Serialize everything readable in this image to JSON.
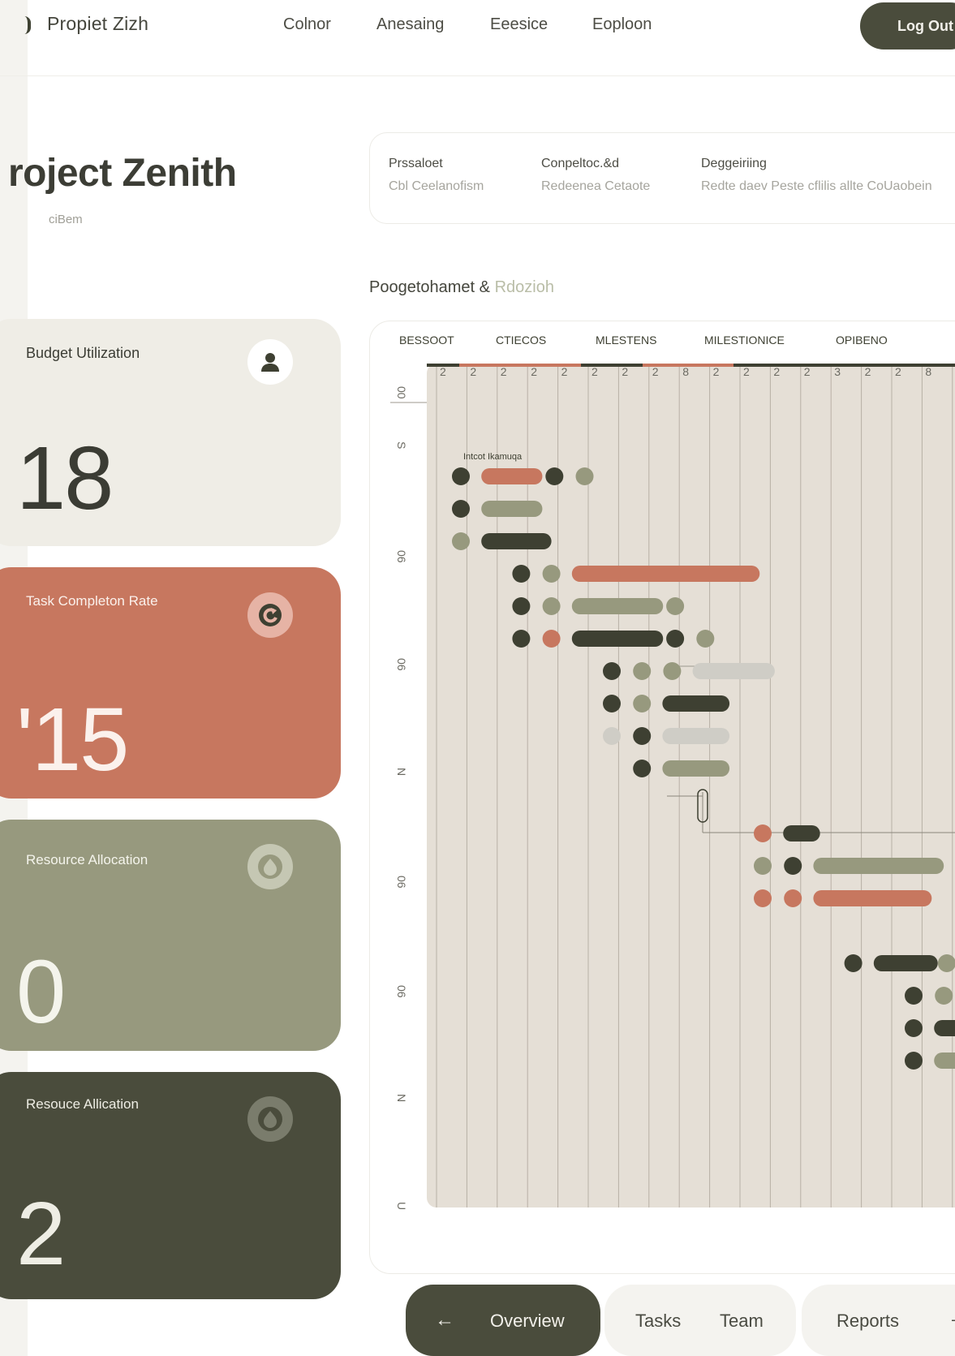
{
  "header": {
    "brand": "Propiet Zizh",
    "nav": [
      "Colnor",
      "Anesaing",
      "Eeesice",
      "Eoploon"
    ],
    "logout": "Log Out"
  },
  "project": {
    "title": "roject Zenith",
    "subtitle": "ciBem"
  },
  "info": [
    {
      "label": "Prssaloet",
      "value": "Cbl Ceelanofism"
    },
    {
      "label": "Conpeltoc.&d",
      "value": "Redeenea Cetaote"
    },
    {
      "label": "Deggeiriing",
      "value": "Redte daev Peste cflilis allte CoUaobein"
    }
  ],
  "cards": [
    {
      "label": "Budget Utilization",
      "value": "18",
      "icon": "person-icon"
    },
    {
      "label": "Task Completon Rate",
      "value": "'15",
      "icon": "refresh-icon"
    },
    {
      "label": "Resource Allocation",
      "value": "0",
      "icon": "drop-icon"
    },
    {
      "label": "Resouce Allication",
      "value": "2",
      "icon": "drop-icon"
    }
  ],
  "chart_heading": {
    "main": "Poogetohamet & ",
    "accent": "Rdozioh"
  },
  "chart_data": {
    "type": "gantt",
    "columns": [
      "BESSOOT",
      "CTIECOS",
      "MLESTENS",
      "MILESTIONICE",
      "OPIBENO"
    ],
    "scale": [
      "2",
      "2",
      "2",
      "2",
      "2",
      "2",
      "2",
      "2",
      "8",
      "2",
      "2",
      "2",
      "2",
      "3",
      "2",
      "2",
      "8"
    ],
    "row_labels": [
      "00",
      "S",
      "06",
      "06",
      "N",
      "06",
      "06",
      "N",
      "U"
    ],
    "task_label": "Intcot Ikamuqa",
    "colors": {
      "dark": "#3e4032",
      "terra": "#c7775f",
      "sage": "#97997e",
      "light": "#cfcdc6",
      "grid_bg": "#e5dfd6"
    },
    "rows": [
      [
        [
          "d",
          "dark",
          0
        ],
        [
          "b",
          "terra",
          1,
          2.7
        ],
        [
          "d",
          "dark",
          3.1
        ],
        [
          "d",
          "sage",
          4.1
        ]
      ],
      [
        [
          "d",
          "dark",
          0
        ],
        [
          "b",
          "sage",
          1,
          2.7
        ]
      ],
      [
        [
          "d",
          "sage",
          0
        ],
        [
          "b",
          "dark",
          1,
          3
        ]
      ],
      [
        [
          "d",
          "dark",
          2
        ],
        [
          "d",
          "sage",
          3
        ],
        [
          "b",
          "terra",
          4,
          9.9
        ]
      ],
      [
        [
          "d",
          "dark",
          2
        ],
        [
          "d",
          "sage",
          3
        ],
        [
          "b",
          "sage",
          4,
          6.7
        ],
        [
          "d",
          "sage",
          7.1
        ]
      ],
      [
        [
          "d",
          "dark",
          2
        ],
        [
          "d",
          "terra",
          3
        ],
        [
          "b",
          "dark",
          4,
          6.7
        ],
        [
          "d",
          "dark",
          7.1
        ],
        [
          "d",
          "sage",
          8.1
        ]
      ],
      [
        [
          "d",
          "dark",
          5
        ],
        [
          "d",
          "sage",
          6
        ],
        [
          "d",
          "sage",
          7
        ],
        [
          "b",
          "light",
          8,
          10.4
        ]
      ],
      [
        [
          "d",
          "dark",
          5
        ],
        [
          "d",
          "sage",
          6
        ],
        [
          "b",
          "dark",
          7,
          8.9
        ]
      ],
      [
        [
          "d",
          "light",
          5
        ],
        [
          "d",
          "dark",
          6
        ],
        [
          "b",
          "light",
          7,
          8.9
        ]
      ],
      [
        [
          "d",
          "dark",
          6
        ],
        [
          "b",
          "sage",
          7,
          8.9
        ]
      ],
      [],
      [
        [
          "d",
          "terra",
          10
        ],
        [
          "b",
          "dark",
          11,
          11.9
        ]
      ],
      [
        [
          "d",
          "sage",
          10
        ],
        [
          "d",
          "dark",
          11
        ],
        [
          "b",
          "sage",
          12,
          16
        ]
      ],
      [
        [
          "d",
          "terra",
          10
        ],
        [
          "d",
          "terra",
          11
        ],
        [
          "b",
          "terra",
          12,
          15.6
        ]
      ],
      [],
      [
        [
          "d",
          "dark",
          13
        ],
        [
          "b",
          "dark",
          14,
          15.8
        ],
        [
          "d",
          "sage",
          16.1
        ],
        [
          "d",
          "light",
          17.1
        ]
      ],
      [
        [
          "d",
          "dark",
          15
        ],
        [
          "d",
          "sage",
          16
        ],
        [
          "b",
          "light",
          17,
          18.5
        ]
      ],
      [
        [
          "d",
          "dark",
          15
        ],
        [
          "b",
          "dark",
          16,
          18.5
        ]
      ],
      [
        [
          "d",
          "dark",
          15
        ],
        [
          "b",
          "sage",
          16,
          18.5
        ]
      ]
    ]
  },
  "tabs": {
    "active": "Overview",
    "items": [
      "Tasks",
      "Team"
    ],
    "reports": "Reports"
  }
}
